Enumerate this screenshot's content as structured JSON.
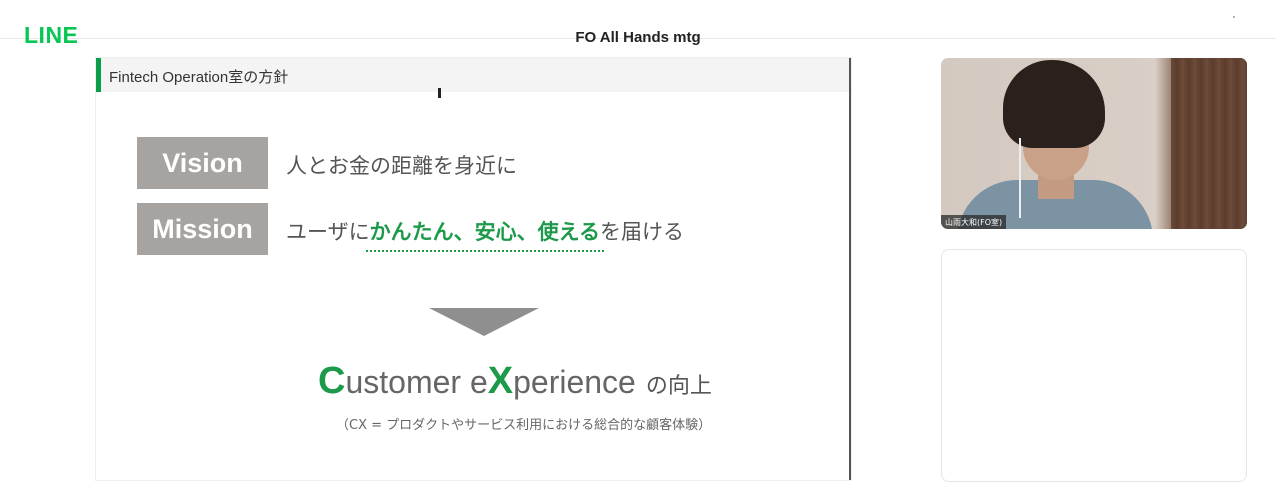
{
  "app": {
    "logo": "LINE",
    "meeting_title": "FO All Hands mtg"
  },
  "slide": {
    "header": "Fintech Operation室の方針",
    "vision": {
      "label": "Vision",
      "text": "人とお金の距離を身近に"
    },
    "mission": {
      "label": "Mission",
      "prefix": "ユーザに",
      "highlight": "かんたん、安心、使える",
      "suffix": "を届ける"
    },
    "cx": {
      "c": "C",
      "ustomer": "ustomer e",
      "x": "X",
      "perience": "perience",
      "no_kojo": "の向上",
      "note": "（CX = プロダクトやサービス利用における総合的な顧客体験）"
    }
  },
  "participant": {
    "name": "山雨大和(FO室)"
  },
  "colors": {
    "brand": "#06c755",
    "accent": "#1c9a4a",
    "tag_bg": "#a7a3a0"
  }
}
